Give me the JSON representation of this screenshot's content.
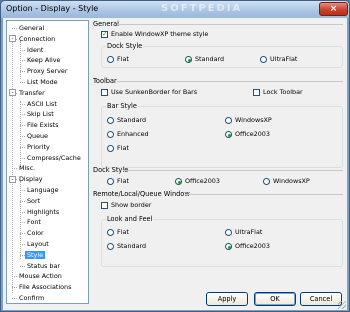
{
  "window": {
    "title": "Option - Display - Style",
    "watermark": "SOFTPEDIA",
    "close_label": "×"
  },
  "tree": {
    "items": [
      {
        "label": "General",
        "level": 0
      },
      {
        "label": "Connection",
        "level": 0,
        "expander": "-"
      },
      {
        "label": "Ident",
        "level": 1
      },
      {
        "label": "Keep Alive",
        "level": 1
      },
      {
        "label": "Proxy Server",
        "level": 1
      },
      {
        "label": "List Mode",
        "level": 1
      },
      {
        "label": "Transfer",
        "level": 0,
        "expander": "-"
      },
      {
        "label": "ASCII List",
        "level": 1
      },
      {
        "label": "Skip List",
        "level": 1
      },
      {
        "label": "File Exists",
        "level": 1
      },
      {
        "label": "Queue",
        "level": 1
      },
      {
        "label": "Priority",
        "level": 1
      },
      {
        "label": "Compress/Cache",
        "level": 1
      },
      {
        "label": "Misc.",
        "level": 0
      },
      {
        "label": "Display",
        "level": 0,
        "expander": "-"
      },
      {
        "label": "Language",
        "level": 1
      },
      {
        "label": "Sort",
        "level": 1
      },
      {
        "label": "Highlights",
        "level": 1
      },
      {
        "label": "Font",
        "level": 1
      },
      {
        "label": "Color",
        "level": 1
      },
      {
        "label": "Layout",
        "level": 1
      },
      {
        "label": "Style",
        "level": 1,
        "selected": true
      },
      {
        "label": "Status bar",
        "level": 1
      },
      {
        "label": "Mouse Action",
        "level": 0
      },
      {
        "label": "File Associations",
        "level": 0
      },
      {
        "label": "Confirm",
        "level": 0
      }
    ]
  },
  "general": {
    "title": "General",
    "enable_xp_label": "Enable WindowXP theme style",
    "dock_style": {
      "title": "Dock Style",
      "options": [
        "Flat",
        "Standard",
        "UltraFlat"
      ],
      "selected": "Standard"
    }
  },
  "toolbar": {
    "title": "Toolbar",
    "sunken_label": "Use SunkenBorder for Bars",
    "lock_label": "Lock Toolbar",
    "bar_style": {
      "title": "Bar Style",
      "options": [
        "Standard",
        "WindowsXP",
        "Enhanced",
        "Office2003",
        "Flat"
      ],
      "selected": "Office2003"
    }
  },
  "dock_style2": {
    "title": "Dock Style",
    "options": [
      "Flat",
      "Office2003",
      "WindowsXP"
    ],
    "selected": "Office2003"
  },
  "remote": {
    "title": "Remote/Local/Queue Window",
    "show_border_label": "Show border",
    "look_feel": {
      "title": "Look and Feel",
      "options": [
        "Flat",
        "UltraFlat",
        "Standard",
        "Office2003"
      ],
      "selected": "Office2003"
    }
  },
  "buttons": {
    "apply": "Apply",
    "ok": "OK",
    "cancel": "Cancel"
  },
  "colors": {
    "accent": "#3399ff",
    "check": "#21a121",
    "titlebar": "#a9c4e2"
  }
}
